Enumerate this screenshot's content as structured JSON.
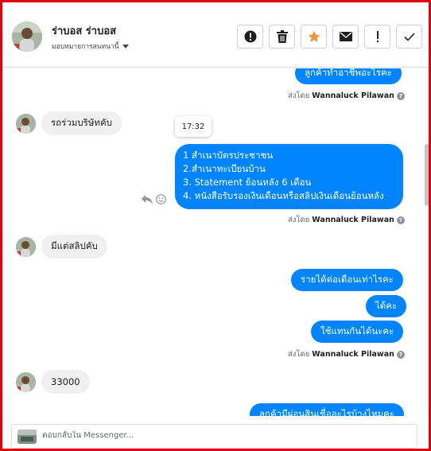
{
  "header": {
    "contact_name": "ร่าบอส ร่าบอส",
    "assign_label": "มอบหมายการสนทนานี้",
    "actions": [
      {
        "icon": "alert-circle-icon",
        "label": "Mark as spam"
      },
      {
        "icon": "trash-icon",
        "label": "Delete"
      },
      {
        "icon": "star-icon",
        "label": "Star"
      },
      {
        "icon": "envelope-icon",
        "label": "Mark as unread"
      },
      {
        "icon": "exclamation-icon",
        "label": "Follow up"
      },
      {
        "icon": "check-icon",
        "label": "Done"
      }
    ]
  },
  "conversation": {
    "messages": [
      {
        "side": "out",
        "text": "ลูกค้าทำอาชีพอะไรคะ"
      },
      {
        "side": "meta",
        "prefix": "ส่งโดย",
        "agent": "Wannaluck Pilawan"
      },
      {
        "side": "in",
        "text": "รถร่วมบริษัทคับ"
      },
      {
        "side": "tooltip",
        "text": "17:32"
      },
      {
        "side": "out",
        "lines": [
          "1 สำเนาบัตรประชาชน",
          "2.สำเนาทะเบียนบ้าน",
          " 3. Statement ย้อนหลัง 6 เดือน",
          "4. หนังสือรับรองเงินเดือนหรือสลิปเงินเดือนย้อนหลัง"
        ]
      },
      {
        "side": "meta",
        "prefix": "ส่งโดย",
        "agent": "Wannaluck Pilawan"
      },
      {
        "side": "in",
        "text": "มีแต่สลิปคับ"
      },
      {
        "side": "out",
        "text": "รายได้ต่อเดือนเท่าไรคะ"
      },
      {
        "side": "out",
        "text": "ได้คะ"
      },
      {
        "side": "out",
        "text": "ใช้แทนกันได้นะคะ"
      },
      {
        "side": "meta",
        "prefix": "ส่งโดย",
        "agent": "Wannaluck Pilawan"
      },
      {
        "side": "in",
        "text": "33000"
      },
      {
        "side": "out",
        "text": "ลูกค้ามีผ่อนสินเชื่ออะไรบ้างไหมคะ"
      }
    ]
  },
  "footer": {
    "reply_placeholder": "ตอบกลับใน Messenger..."
  },
  "colors": {
    "accent": "#0084ff",
    "incoming_bubble": "#f1f0f0",
    "border": "#e3000f",
    "star": "#f7923a"
  }
}
